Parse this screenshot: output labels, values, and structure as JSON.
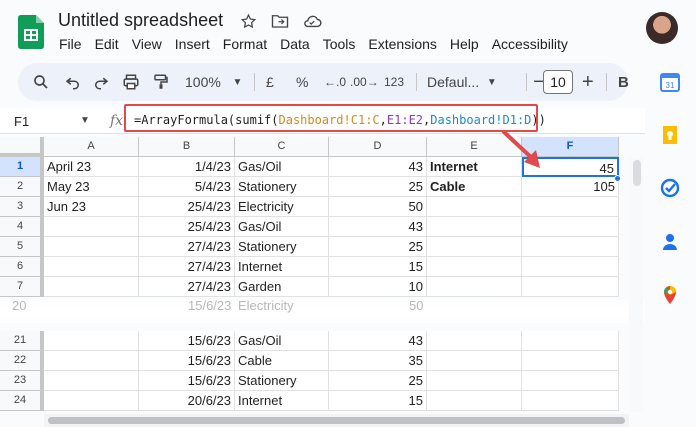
{
  "app": {
    "doc_title": "Untitled spreadsheet"
  },
  "menu": [
    "File",
    "Edit",
    "View",
    "Insert",
    "Format",
    "Data",
    "Tools",
    "Extensions",
    "Help",
    "Accessibility"
  ],
  "toolbar": {
    "zoom": "100%",
    "currency": "£",
    "percent": "%",
    "decrease_decimal": ".0",
    "increase_decimal": ".00",
    "number_format": "123",
    "font": "Defaul...",
    "font_size": "10",
    "bold": "B"
  },
  "formula_bar": {
    "cell_ref": "F1",
    "fx": "fx",
    "formula_parts": [
      {
        "text": "=ArrayFormula(sumif(",
        "color": "default"
      },
      {
        "text": "Dashboard!C1:C",
        "color": "orange"
      },
      {
        "text": ",",
        "color": "default"
      },
      {
        "text": "E1:E2",
        "color": "purple"
      },
      {
        "text": ",",
        "color": "default"
      },
      {
        "text": "Dashboard!D1:D",
        "color": "blue"
      },
      {
        "text": "))",
        "color": "default"
      }
    ]
  },
  "columns": [
    "A",
    "B",
    "C",
    "D",
    "E",
    "F"
  ],
  "rows": [
    {
      "num": "1",
      "a": "April 23",
      "b": "1/4/23",
      "c": "Gas/Oil",
      "d": "43",
      "e": "Internet",
      "f": "45"
    },
    {
      "num": "2",
      "a": "May 23",
      "b": "5/4/23",
      "c": "Stationery",
      "d": "25",
      "e": "Cable",
      "f": "105"
    },
    {
      "num": "3",
      "a": "Jun 23",
      "b": "25/4/23",
      "c": "Electricity",
      "d": "50",
      "e": "",
      "f": ""
    },
    {
      "num": "4",
      "a": "",
      "b": "25/4/23",
      "c": "Gas/Oil",
      "d": "43",
      "e": "",
      "f": ""
    },
    {
      "num": "5",
      "a": "",
      "b": "27/4/23",
      "c": "Stationery",
      "d": "25",
      "e": "",
      "f": ""
    },
    {
      "num": "6",
      "a": "",
      "b": "27/4/23",
      "c": "Internet",
      "d": "15",
      "e": "",
      "f": ""
    },
    {
      "num": "7",
      "a": "",
      "b": "27/4/23",
      "c": "Garden",
      "d": "10",
      "e": "",
      "f": ""
    },
    {
      "num": "21",
      "a": "",
      "b": "15/6/23",
      "c": "Gas/Oil",
      "d": "43",
      "e": "",
      "f": ""
    },
    {
      "num": "22",
      "a": "",
      "b": "15/6/23",
      "c": "Cable",
      "d": "35",
      "e": "",
      "f": ""
    },
    {
      "num": "23",
      "a": "",
      "b": "15/6/23",
      "c": "Stationery",
      "d": "25",
      "e": "",
      "f": ""
    },
    {
      "num": "24",
      "a": "",
      "b": "20/6/23",
      "c": "Internet",
      "d": "15",
      "e": "",
      "f": ""
    }
  ],
  "ghost_row": {
    "num": "20",
    "b": "15/6/23",
    "c": "Electricity",
    "d": "50"
  },
  "colors": {
    "accent": "#1a73e8",
    "annotation": "#e04a4a"
  }
}
